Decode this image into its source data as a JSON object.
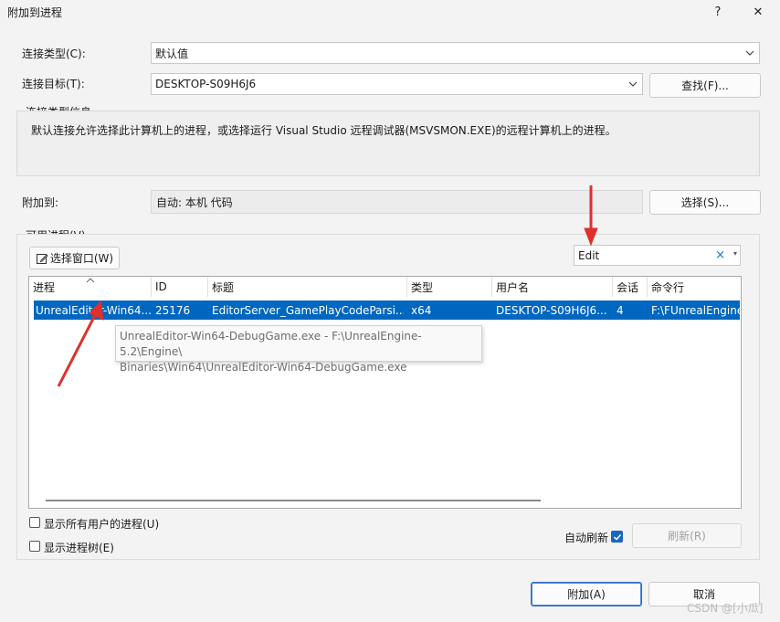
{
  "window": {
    "title": "附加到进程",
    "help_label": "?",
    "close_label": "✕"
  },
  "connection": {
    "type_label": "连接类型(C):",
    "type_value": "默认值",
    "target_label": "连接目标(T):",
    "target_value": "DESKTOP-S09H6J6",
    "find_button": "查找(F)..."
  },
  "info": {
    "group_label": "连接类型信息",
    "description": "默认连接允许选择此计算机上的进程，或选择运行 Visual Studio 远程调试器(MSVSMON.EXE)的远程计算机上的进程。"
  },
  "attach_to": {
    "label": "附加到:",
    "value": "自动: 本机 代码",
    "select_button": "选择(S)..."
  },
  "processes": {
    "group_label": "可用进程(V)",
    "select_window_button": "选择窗口(W)",
    "filter_value": "Edit",
    "columns": [
      "进程",
      "ID",
      "标题",
      "类型",
      "用户名",
      "会话",
      "命令行"
    ],
    "rows": [
      {
        "process": "UnrealEditor-Win64...",
        "id": "25176",
        "title": "EditorServer_GamePlayCodeParsi...",
        "type": "x64",
        "user": "DESKTOP-S09H6J6...",
        "session": "4",
        "cmdline": "F:\\FUnrealEngine"
      }
    ],
    "tooltip_line1": "UnrealEditor-Win64-DebugGame.exe - F:\\UnrealEngine-5.2\\Engine\\",
    "tooltip_line2": "Binaries\\Win64\\UnrealEditor-Win64-DebugGame.exe"
  },
  "options": {
    "show_all_users": "显示所有用户的进程(U)",
    "show_tree": "显示进程树(E)",
    "auto_refresh": "自动刷新",
    "refresh_button": "刷新(R)"
  },
  "footer": {
    "attach_button": "附加(A)",
    "cancel_button": "取消",
    "watermark": "CSDN @[小瓜]"
  },
  "colors": {
    "selection": "#0067c0",
    "annotation_arrow": "#e0302b"
  }
}
